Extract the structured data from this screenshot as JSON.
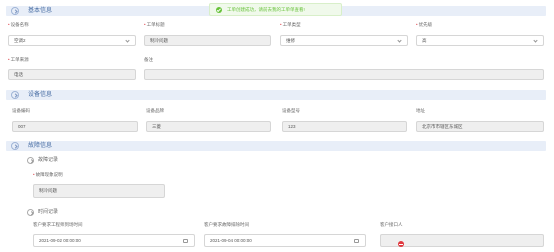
{
  "toast": {
    "message": "工单创建成功，请前去我的工单单查看!"
  },
  "sections": {
    "basic": {
      "title": "基本信息"
    },
    "device": {
      "title": "设备信息"
    },
    "failure": {
      "title": "故障信息"
    }
  },
  "basic": {
    "device_name": {
      "label": "设备名称",
      "value": "空调2"
    },
    "ticket_title": {
      "label": "工单标题",
      "value": "制冷问题"
    },
    "ticket_type": {
      "label": "工单类型",
      "value": "维修"
    },
    "priority": {
      "label": "优先级",
      "value": "高"
    },
    "ticket_source": {
      "label": "工单来源",
      "value": "电话"
    },
    "remark": {
      "label": "备注",
      "value": ""
    }
  },
  "device": {
    "code": {
      "label": "设备编码",
      "value": "007"
    },
    "brand": {
      "label": "设备品牌",
      "value": "三菱"
    },
    "model": {
      "label": "设备型号",
      "value": "123"
    },
    "address": {
      "label": "地址",
      "value": "北京市市辖区东城区"
    }
  },
  "failure": {
    "record": {
      "title": "故障记录",
      "description": {
        "label": "故障现象说明",
        "value": "制冷问题"
      }
    },
    "time": {
      "title": "时间记录",
      "required_time": {
        "label": "客户要求工程师到场时间",
        "value": "2021-09-02 00:00:00"
      },
      "reported_time": {
        "label": "客户要求故障排除时间",
        "value": "2021-09-04 00:00:00"
      },
      "contact": {
        "label": "客户接口人",
        "value": ""
      }
    }
  }
}
